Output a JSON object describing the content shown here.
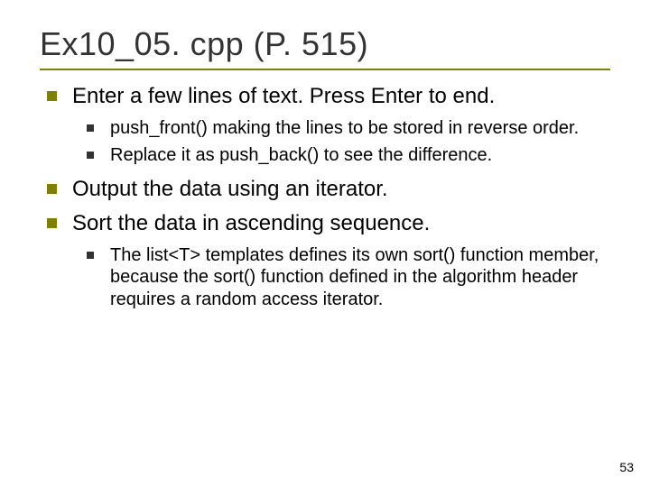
{
  "title": "Ex10_05. cpp (P. 515)",
  "items": [
    {
      "text": "Enter a few lines of text. Press Enter to end.",
      "sub": [
        "push_front() making the lines to be stored in reverse order.",
        "Replace it as push_back() to see the difference."
      ]
    },
    {
      "text": "Output the data using an iterator.",
      "sub": []
    },
    {
      "text": "Sort the data in ascending sequence.",
      "sub": [
        "The list<T> templates defines its own sort() function member, because the sort() function defined in the algorithm header requires a random access iterator."
      ]
    }
  ],
  "page_number": "53"
}
